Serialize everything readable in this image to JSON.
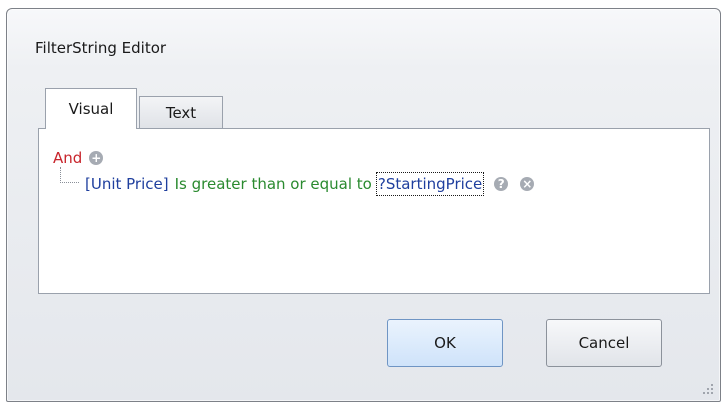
{
  "window": {
    "title": "FilterString Editor"
  },
  "tabs": [
    {
      "label": "Visual",
      "active": true
    },
    {
      "label": "Text",
      "active": false
    }
  ],
  "filter": {
    "group_operator": "And",
    "add_icon": "plus-circle-icon",
    "condition": {
      "field": "[Unit Price]",
      "operator": "Is greater than or equal to",
      "value": "?StartingPrice",
      "help_icon": "question-circle-icon",
      "remove_icon": "x-circle-icon"
    }
  },
  "buttons": {
    "ok_label": "OK",
    "cancel_label": "Cancel"
  },
  "colors": {
    "group_operator": "#c8242b",
    "field": "#1f3f9e",
    "operator": "#2a8a2f",
    "value": "#1f3f9e"
  }
}
